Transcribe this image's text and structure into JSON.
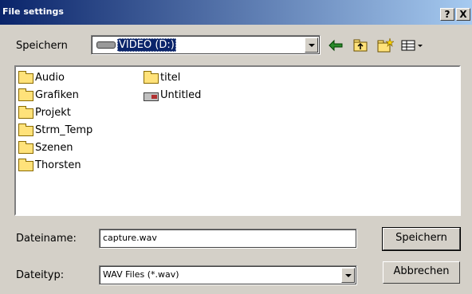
{
  "window": {
    "title": "File settings",
    "help_label": "?",
    "close_label": "X"
  },
  "location": {
    "label": "Speichern",
    "selected_drive": "VIDEO (D:)",
    "drive_icon": "hard-drive-icon",
    "toolbar_icons": [
      "back-arrow-icon",
      "up-folder-icon",
      "new-folder-icon",
      "view-menu-icon"
    ]
  },
  "files": {
    "column1": [
      {
        "name": "Audio",
        "type": "folder"
      },
      {
        "name": "Grafiken",
        "type": "folder"
      },
      {
        "name": "Projekt",
        "type": "folder"
      },
      {
        "name": "Strm_Temp",
        "type": "folder"
      },
      {
        "name": "Szenen",
        "type": "folder"
      },
      {
        "name": "Thorsten",
        "type": "folder"
      }
    ],
    "column2": [
      {
        "name": "titel",
        "type": "folder"
      },
      {
        "name": "Untitled",
        "type": "file"
      }
    ]
  },
  "filename": {
    "label": "Dateiname:",
    "value": "capture.wav"
  },
  "filetype": {
    "label": "Dateityp:",
    "value": "WAV Files (*.wav)"
  },
  "buttons": {
    "save": "Speichern",
    "cancel": "Abbrechen"
  },
  "colors": {
    "titlebar_start": "#0a246a",
    "titlebar_end": "#a6caf0",
    "face": "#d4d0c8",
    "selection": "#0a246a"
  }
}
